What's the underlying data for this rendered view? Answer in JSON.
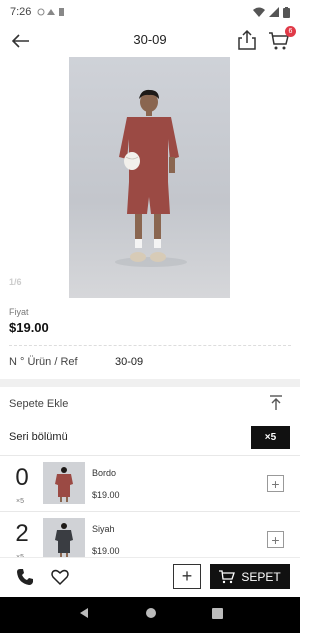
{
  "status_bar": {
    "time": "7:26"
  },
  "header": {
    "title": "30-09",
    "cart_count": "6"
  },
  "gallery": {
    "indicator": "1/6"
  },
  "price": {
    "label": "Fiyat",
    "value": "$19.00"
  },
  "reference": {
    "label": "N ° Ürün / Ref",
    "value": "30-09"
  },
  "add_to_cart": {
    "label": "Sepete Ekle"
  },
  "series": {
    "label": "Seri bölümü",
    "multiplier": "×5"
  },
  "variants": [
    {
      "qty": "0",
      "multiplier": "×5",
      "name": "Bordo",
      "price": "$19.00"
    },
    {
      "qty": "2",
      "multiplier": "×5",
      "name": "Siyah",
      "price": "$19.00"
    }
  ],
  "bottom_bar": {
    "cart_button": "SEPET"
  },
  "colors": {
    "accent_badge": "#e03a48",
    "primary_dark": "#111111",
    "shirt_bordo": "#9b4a44"
  }
}
